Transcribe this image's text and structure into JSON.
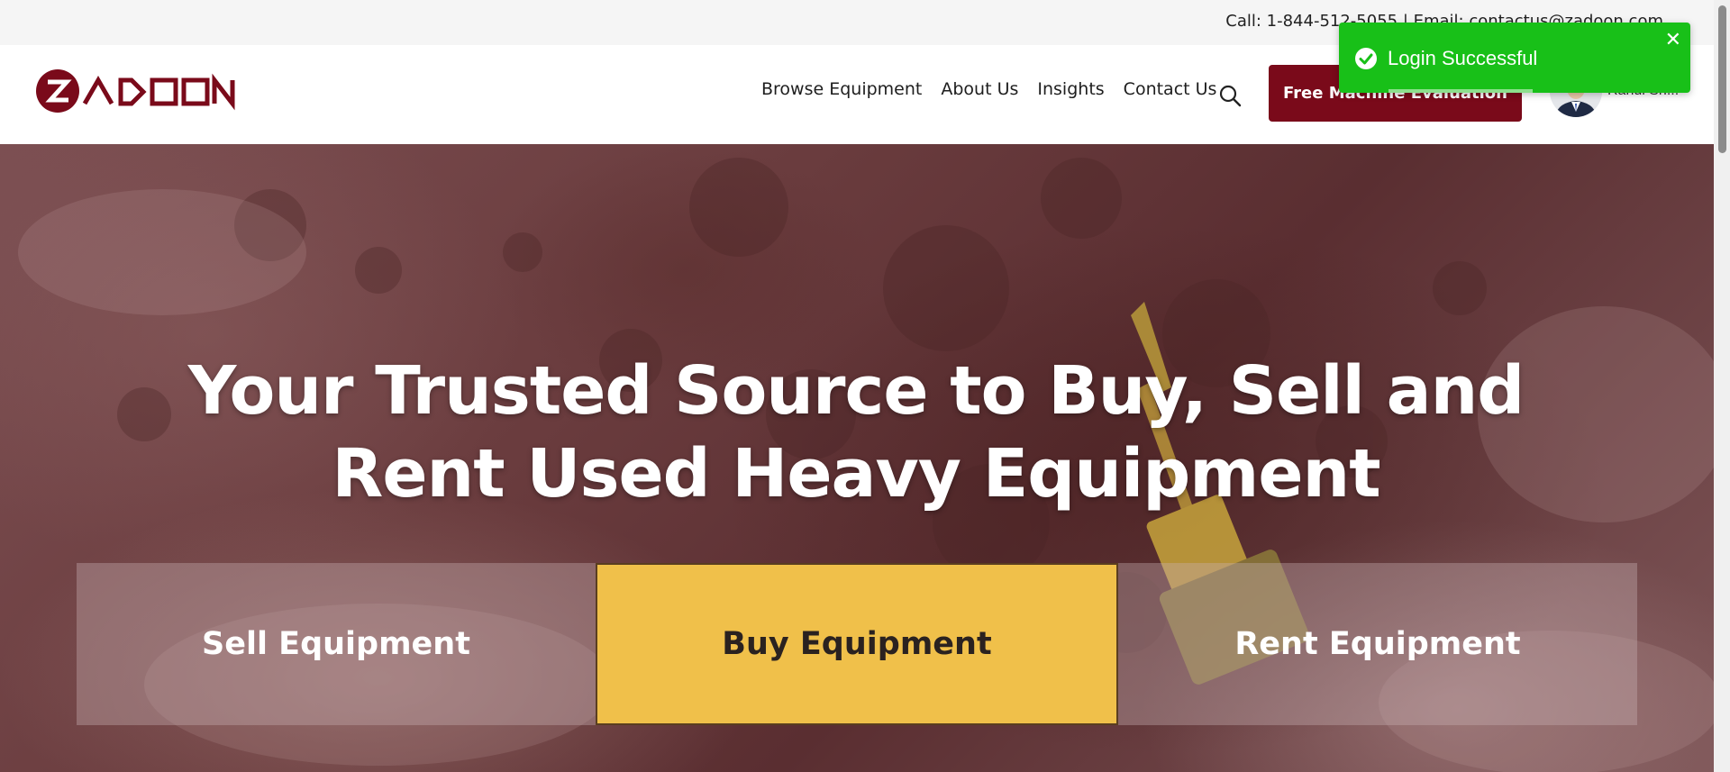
{
  "topbar": {
    "text": "Call: 1-844-512-5055 | Email: contactus@zadoon.com"
  },
  "header": {
    "logo_text": "ZADOON",
    "nav": [
      {
        "label": "Browse Equipment"
      },
      {
        "label": "About Us"
      },
      {
        "label": "Insights"
      },
      {
        "label": "Contact Us"
      }
    ],
    "search_icon": "search-icon",
    "cta_label": "Free Machine Evaluation",
    "user_name": "Rahul Sh..."
  },
  "hero": {
    "title_line1": "Your Trusted Source to Buy, Sell and",
    "title_line2": "Rent Used Heavy Equipment",
    "tiles": [
      {
        "label": "Sell Equipment",
        "active": false
      },
      {
        "label": "Buy Equipment",
        "active": true
      },
      {
        "label": "Rent Equipment",
        "active": false
      }
    ]
  },
  "toast": {
    "message": "Login Successful",
    "icon": "check-circle-icon",
    "close_icon": "close-icon"
  },
  "colors": {
    "brand": "#7a0a1a",
    "active_tile": "#f0c04a",
    "toast_success": "#18c018"
  }
}
